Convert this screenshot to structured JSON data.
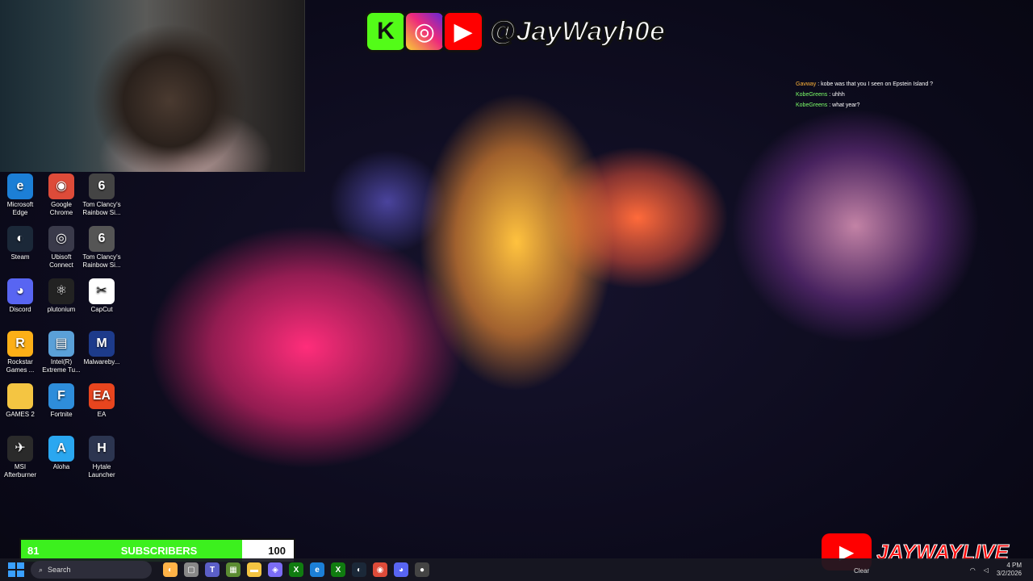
{
  "overlay": {
    "handle": "@JayWayh0e",
    "brand_tiles": [
      {
        "letter": "K",
        "icon": "kick-logo"
      },
      {
        "letter": "◎",
        "icon": "instagram-logo"
      },
      {
        "letter": "▶",
        "icon": "youtube-logo"
      }
    ],
    "channel_name": "JAYWAYLIVE"
  },
  "chat": [
    {
      "user": "Gavway",
      "text": " : kobe was that you I seen on Epstein Island ?"
    },
    {
      "user": "KobeGreens",
      "text": " : uhhh"
    },
    {
      "user": "KobeGreens",
      "text": " : what year?"
    }
  ],
  "desktop_icons": [
    {
      "label": "Microsoft Edge",
      "glyph": "e",
      "color": "#1c7fd6",
      "icon": "edge-icon"
    },
    {
      "label": "Google Chrome",
      "glyph": "◉",
      "color": "#dd4b39",
      "icon": "chrome-icon"
    },
    {
      "label": "Tom Clancy's Rainbow Si...",
      "glyph": "6",
      "color": "#444444",
      "icon": "rainbow-six-icon"
    },
    {
      "label": "Steam",
      "glyph": "◐",
      "color": "#1b2838",
      "icon": "steam-icon"
    },
    {
      "label": "Ubisoft Connect",
      "glyph": "◎",
      "color": "#3a3a4a",
      "icon": "ubisoft-icon"
    },
    {
      "label": "Tom Clancy's Rainbow Si...",
      "glyph": "6",
      "color": "#555555",
      "icon": "rainbow-six-icon"
    },
    {
      "label": "Discord",
      "glyph": "◕",
      "color": "#5865f2",
      "icon": "discord-icon"
    },
    {
      "label": "plutonium",
      "glyph": "⚛",
      "color": "#222222",
      "icon": "plutonium-icon"
    },
    {
      "label": "CapCut",
      "glyph": "✂",
      "color": "#ffffff",
      "icon": "capcut-icon"
    },
    {
      "label": "Rockstar Games ...",
      "glyph": "R",
      "color": "#fcaf17",
      "icon": "rockstar-icon"
    },
    {
      "label": "Intel(R) Extreme Tu...",
      "glyph": "▤",
      "color": "#5aa0d8",
      "icon": "intel-xtu-icon"
    },
    {
      "label": "Malwareby...",
      "glyph": "M",
      "color": "#1d3b8b",
      "icon": "malwarebytes-icon"
    },
    {
      "label": "GAMES 2",
      "glyph": "",
      "color": "#f4c542",
      "icon": "folder-icon"
    },
    {
      "label": "Fortnite",
      "glyph": "F",
      "color": "#2e8ddb",
      "icon": "fortnite-icon"
    },
    {
      "label": "EA",
      "glyph": "EA",
      "color": "#e8451e",
      "icon": "ea-icon"
    },
    {
      "label": "MSI Afterburner",
      "glyph": "✈",
      "color": "#2a2a2a",
      "icon": "msi-afterburner-icon"
    },
    {
      "label": "Aloha",
      "glyph": "A",
      "color": "#2aa7f0",
      "icon": "aloha-icon"
    },
    {
      "label": "Hytale Launcher",
      "glyph": "H",
      "color": "#2c3550",
      "icon": "hytale-icon"
    }
  ],
  "subscribers": {
    "current": "81",
    "label": "SUBSCRIBERS",
    "goal": "100",
    "progress": 0.81
  },
  "taskbar": {
    "search_placeholder": "Search",
    "apps": [
      {
        "icon": "widgets-icon",
        "glyph": "◐",
        "color": "#ffb347"
      },
      {
        "icon": "task-view-icon",
        "glyph": "▢",
        "color": "#888888"
      },
      {
        "icon": "teams-icon",
        "glyph": "T",
        "color": "#5b5fc7"
      },
      {
        "icon": "minecraft-icon",
        "glyph": "▦",
        "color": "#5b8c32"
      },
      {
        "icon": "file-explorer-icon",
        "glyph": "▬",
        "color": "#f4c542"
      },
      {
        "icon": "copilot-icon",
        "glyph": "◈",
        "color": "#7b6cf6"
      },
      {
        "icon": "xbox-icon",
        "glyph": "X",
        "color": "#107c10"
      },
      {
        "icon": "edge-icon",
        "glyph": "e",
        "color": "#1c7fd6"
      },
      {
        "icon": "xbox-icon",
        "glyph": "X",
        "color": "#107c10"
      },
      {
        "icon": "steam-icon",
        "glyph": "◐",
        "color": "#1b2838"
      },
      {
        "icon": "chrome-icon",
        "glyph": "◉",
        "color": "#dd4b39"
      },
      {
        "icon": "discord-icon",
        "glyph": "◕",
        "color": "#5865f2"
      },
      {
        "icon": "obs-icon",
        "glyph": "●",
        "color": "#444444"
      }
    ],
    "weather": "Clear",
    "time": "4 PM",
    "date": "3/2/2026"
  }
}
